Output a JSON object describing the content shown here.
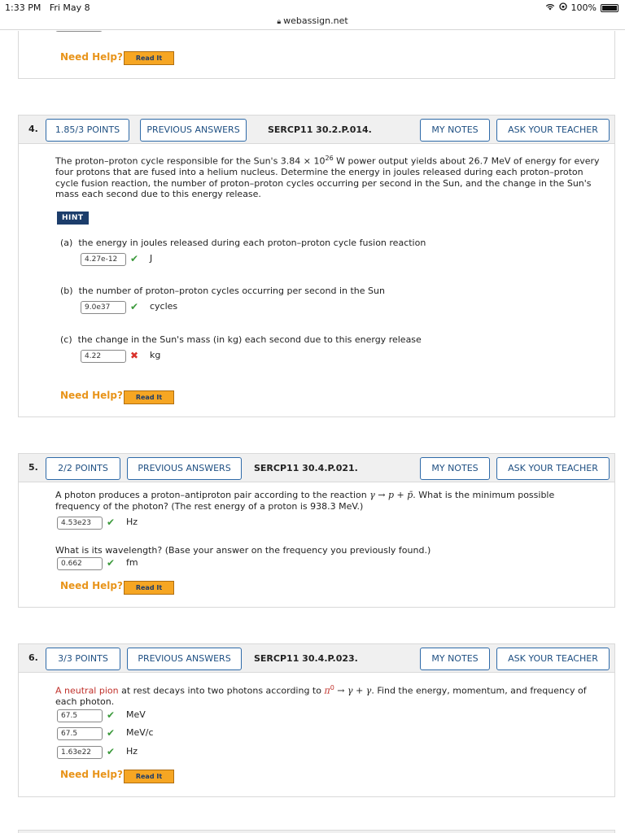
{
  "status": {
    "time": "1:33 PM",
    "date": "Fri May 8",
    "battery": "100%"
  },
  "browser": {
    "url": "webassign.net"
  },
  "help": {
    "need_help": "Need Help?",
    "read_it": "Read It"
  },
  "q4": {
    "number": "4.",
    "points": "1.85/3 POINTS",
    "prev": "PREVIOUS ANSWERS",
    "code": "SERCP11 30.2.P.014.",
    "notes": "MY NOTES",
    "ask": "ASK YOUR TEACHER",
    "question_pre": "The proton–proton cycle responsible for the Sun's 3.84 × 10",
    "question_exp": "26",
    "question_post": " W power output yields about 26.7 MeV of energy for every four protons that are fused into a helium nucleus. Determine the energy in joules released during each proton–proton cycle fusion reaction, the number of proton–proton cycles occurring per second in the Sun, and the change in the Sun's mass each second due to this energy release.",
    "hint": "HINT",
    "parts": [
      {
        "label": "(a)",
        "text": "the energy in joules released during each proton–proton cycle fusion reaction",
        "value": "4.27e-12",
        "unit": "J",
        "status": "correct"
      },
      {
        "label": "(b)",
        "text": "the number of proton–proton cycles occurring per second in the Sun",
        "value": "9.0e37",
        "unit": "cycles",
        "status": "correct"
      },
      {
        "label": "(c)",
        "text": "the change in the Sun's mass (in kg) each second due to this energy release",
        "value": "4.22",
        "unit": "kg",
        "status": "incorrect"
      }
    ]
  },
  "q5": {
    "number": "5.",
    "points": "2/2 POINTS",
    "prev": "PREVIOUS ANSWERS",
    "code": "SERCP11 30.4.P.021.",
    "notes": "MY NOTES",
    "ask": "ASK YOUR TEACHER",
    "question_a_pre": "A photon produces a proton–antiproton pair according to the reaction ",
    "reaction": "γ → p + p̄",
    "question_a_post": ". What is the minimum possible frequency of the photon? (The rest energy of a proton is 938.3 MeV.)",
    "answer1": "4.53e23",
    "unit1": "Hz",
    "question_b": "What is its wavelength? (Base your answer on the frequency you previously found.)",
    "answer2": "0.662",
    "unit2": "fm"
  },
  "q6": {
    "number": "6.",
    "points": "3/3 POINTS",
    "prev": "PREVIOUS ANSWERS",
    "code": "SERCP11 30.4.P.023.",
    "notes": "MY NOTES",
    "ask": "ASK YOUR TEACHER",
    "link": "A neutral pion",
    "question_pre": " at rest decays into two photons according to ",
    "pion": "π",
    "pion_sup": "0",
    "reaction": " → γ + γ",
    "question_post": ". Find the energy, momentum, and frequency of each photon.",
    "answers": [
      {
        "value": "67.5",
        "unit": "MeV"
      },
      {
        "value": "67.5",
        "unit": "MeV/c"
      },
      {
        "value": "1.63e22",
        "unit": "Hz"
      }
    ]
  },
  "colors": {
    "button_border": "#2e6aa8",
    "read_it": "#f6a623",
    "need_help": "#e8941a",
    "correct": "#3c9a3c",
    "incorrect": "#d9312b",
    "hint_bg": "#1c3d6b"
  }
}
